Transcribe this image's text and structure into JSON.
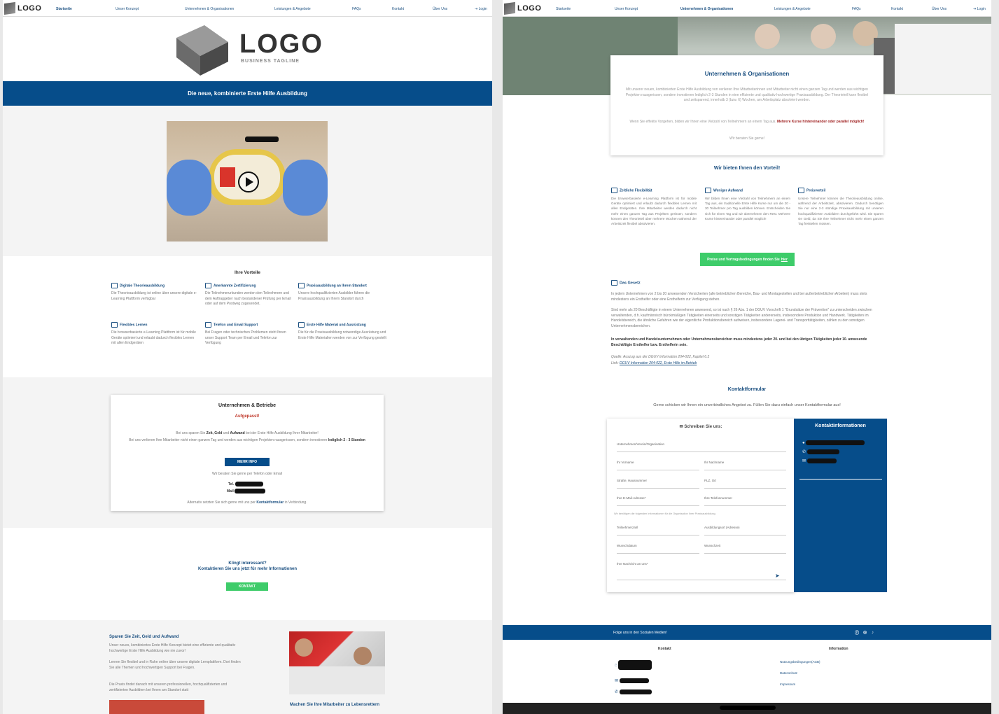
{
  "nav": {
    "logo": "LOGO",
    "logo_sub": "BUSINESS TAGLINE",
    "items": [
      "Startseite",
      "Unser Konzept",
      "Unternehmen & Organisationen",
      "Leistungen & Angebote",
      "FAQs",
      "Kontakt",
      "Über Uns"
    ],
    "login": "Login"
  },
  "left": {
    "big_logo": "LOGO",
    "big_logo_sub": "BUSINESS TAGLINE",
    "banner": "Die neue, kombinierte Erste Hilfe Ausbildung",
    "benefits_title": "Ihre Vorteile",
    "benefits": [
      {
        "icon": "laptop-icon",
        "title": "Digitale Theorieausbildung",
        "text": "Die Theorieausbildung ist online über unsere digitale e-Learning Plattform verfügbar"
      },
      {
        "icon": "certificate-icon",
        "title": "Anerkannte Zertifizierung",
        "text": "Die Teilnehmerurkunden werden den Teilnehmern und dem Auftraggeber nach bestandener Prüfung per Email oder auf dem Postweg zugesendet."
      },
      {
        "icon": "location-icon",
        "title": "Praxisausbildung an Ihrem Standort",
        "text": "Unsere hochqualifizierten Ausbilder führen die Praxisausbildung an Ihrem Standort durch"
      },
      {
        "icon": "clock-icon",
        "title": "Flexibles Lernen",
        "text": "Die browserbasierte e-Learning Plattform ist für mobile Geräte optimiert und erlaubt dadurch flexibles Lernen mit allen Endgeräten"
      },
      {
        "icon": "phone-icon",
        "title": "Telefon und Email Support",
        "text": "Bei Fragen oder technischen Problemen steht Ihnen unser Support Team per Email und Telefon zur Verfügung"
      },
      {
        "icon": "firstaid-icon",
        "title": "Erste Hilfe Material und Ausrüstung",
        "text": "Die für die Praxisausbildung notwendige Ausrüstung und Erste Hilfe Materialien werden von zur Verfügung gestellt"
      }
    ],
    "card_title": "Unternehmen & Betriebe",
    "card_alert": "Aufgepasst!",
    "card_text1a": "Bei uns sparen Sie ",
    "card_text1b": "Zeit, Geld",
    "card_text1c": " und ",
    "card_text1d": "Aufwand",
    "card_text1e": " bei der Erste Hilfe Ausbildung Ihrer Mitarbeiter!",
    "card_text2a": "Bei uns verlieren Ihre Mitarbeiter nicht einen ganzen Tag und werden aus wichtigen Projekten rausgerissen, sondern investieren ",
    "card_text2b": "lediglich 2 - 3 Stunden",
    "card_button": "MEHR INFO",
    "card_contact": "Wir beraten Sie gerne per Telefon oder Email",
    "card_tel": "Tel.",
    "card_mail": "Mail",
    "card_footer_a": "Alternativ setzten Sie sich gerne mit uns per ",
    "card_footer_b": "Kontaktformular",
    "card_footer_c": " in Verbindung.",
    "cta1": "Klingt interessant?",
    "cta2": "Kontaktieren Sie uns jetzt für mehr Informationen",
    "cta_button": "KONTAKT",
    "bottom_title": "Sparen Sie Zeit, Geld und Aufwand",
    "bottom_p1": "Unser neues, kombiniertes Erste Hilfe Konzept bietet eine effiziente und qualitativ hochwertige Erste Hilfe Ausbildung wie nie zuvor!",
    "bottom_p2": "Lernen Sie flexibel und in Ruhe online über unsere digitale Lernplattform. Dort finden Sie alle Themen und hochwertigen Support bei Fragen.",
    "bottom_p3": "Die Praxis findet danach mit unseren professionellen, hochqualifizierten und zertifizierten Ausbildern bei Ihnen am Standort statt",
    "bottom_caption": "Machen Sie Ihre Mitarbeiter zu Lebensrettern"
  },
  "right": {
    "card_title": "Unternehmen & Organisationen",
    "card_p1": "Mit unserer neuen, kombinierten Erste Hilfe Ausbildung von verlieren Ihre Mitarbeiterinnen und Mitarbeiter nicht einen ganzen Tag und werden aus wichtigen Projekten rausgerissen, sondern investieren lediglich 2-3 Stunden in eine effiziente und qualitativ hochwertige Praxisausbildung. Der Theorieteil kann flexibel und zeitsparend, innerhalb 3 (bzw. 6) Wochen, am Arbeitsplatz absolviert werden.",
    "card_p2a": "Wenn Sie effektiv Vorgehen, bilden wir Ihnen eine Vielzahl von Teilnehmern an einem Tag aus. ",
    "card_p2b": "Mehrere Kurse hintereinander oder parallel möglich!",
    "card_p3": "Wir beraten Sie gerne!",
    "vorteil_title": "Wir bieten Ihnen den Vorteil!",
    "vorteile": [
      {
        "icon": "clock-icon",
        "title": "Zeitliche Flexibilität",
        "text": "Die browserbasierte e-Learning Plattform ist für mobile Geräte optimiert und erlaubt dadurch flexibles Lernen mit allen Endgeräten. Ihre Mitarbeiter werden dadurch nicht mehr einen ganzen Tag aus Projekten gerissen, sondern können den Theorieteil über mehrere Wochen während der Arbeitszeit flexibel absolvieren."
      },
      {
        "icon": "briefcase-icon",
        "title": "Weniger Aufwand",
        "text": "Wir bilden Ihnen eine Vielzahl von Teilnehmern an einem Tag aus, ein traditionelle Erste Hilfe Kurse nur um die 20 - 30 Teilnehmer pro Tag ausbilden können. Entscheiden Sie sich für einen Tag und wir übernehmen den Rest. Mehrere Kurse hintereinander oder parallel möglich!"
      },
      {
        "icon": "receipt-icon",
        "title": "Preisvorteil",
        "text": "Unsere Teilnehmer können die Theorieausbildung online, während der Arbeitszeit, absolvieren. Dadurch benötigen Sie nur eine 2-3 stündige Praxisausbildung mit unseren hochqualifizierten Ausbildern durchgeführt wird. Sie sparen vie Geld, da Sie Ihre Teilnehmer nicht mehr einen ganzen Tag freistellen müssen."
      }
    ],
    "green_button_a": "Preise und Vertragsbedingungen finden Sie ",
    "green_button_b": "hier",
    "law_title": "Das Gesetz",
    "law_p1": "In jedem Unternehmen von 2 bis 20 anwesenden Versicherten (alle betrieblichen Bereiche, Bau- und Montagestellen und bei außerbetrieblichen Arbeiten) muss stets mindestens ein Ersthelfer oder eine Ersthelferin zur Verfügung stehen.",
    "law_p2": "Sind mehr als 20 Beschäftigte in einem Unternehmen anwesend, so ist nach § 26 Abs. 1 der DGUV Vorschrift 1 \"Grundsätze der Prävention\" zu unterscheiden zwischen verwaltenden, d.h. kaufmännisch bürokmäßigen Tätigkeiten einerseits und sonstigen Tätigkeiten andererseits, insbesondere Produktion und Handwerk. Tätigkeiten im Handelsbereich, die ähnliche Gefahren wie der eigentliche Produktionsbereich aufweisen, insbesondere Lagerei- und Transporttätigkeiten, zählen zu den sonstigen Unternehmensbereichen.",
    "law_p3": "In verwaltenden und Handelsunternehmen oder Unternehmensbereichen muss mindestens jeder 20. und bei den übrigen Tätigkeiten jeder 10. anwesende Beschäftigte Ersthelfer bzw. Ersthelferin sein.",
    "law_src": "Quelle: Auszug aus der DGUV Information 204-022, Kapitel 6.3",
    "law_link_a": "Link: ",
    "law_link_b": "DGUV Information 204-022, Erste Hilfe im Betrieb",
    "kontakt_title": "Kontaktformular",
    "kontakt_sub": "Gerne schicken wir Ihnen ein unverbindliches Angebot zu. Füllen Sie dazu einfach unser Kontaktformular aus!",
    "form_title": "Schreiben Sie uns:",
    "form_fields": {
      "org": "Unternehmen/Verein/Organisation",
      "vorname": "Ihr Vorname",
      "nachname": "Ihr Nachname",
      "strasse": "Straße, Hausnummer",
      "plz": "PLZ, Ort",
      "email": "Ihre E-Mail-Adresse*",
      "telefon": "Ihre Telefonnummer",
      "hint": "Wir benötigen die folgenden Informationen für die Organisation Ihrer Praxisausbildung.",
      "anzahl": "Teilnehmerzahl",
      "ort": "Ausbildungsort (Adresse)",
      "datum": "Wunschdatum",
      "zeit": "Wunschzeit",
      "nachricht": "Ihre Nachricht an uns*"
    },
    "info_title": "Kontaktinformationen",
    "social_text": "Folge uns in den Sozialen Medien!",
    "footer_kontakt": "Kontakt",
    "footer_info": "Information",
    "footer_links": [
      "Nutzungsbedingungen(AGB)",
      "Datenschutz",
      "Impressum"
    ]
  },
  "colors": {
    "primary": "#064d8a",
    "green": "#3ecc6a",
    "red": "#c0392b"
  }
}
